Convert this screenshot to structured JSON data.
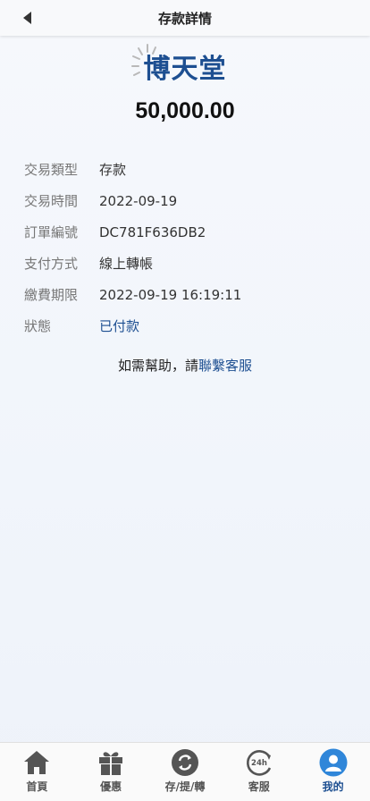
{
  "header": {
    "title": "存款詳情"
  },
  "logo": {
    "text": "博天堂"
  },
  "amount": "50,000.00",
  "details": [
    {
      "label": "交易類型",
      "value": "存款"
    },
    {
      "label": "交易時間",
      "value": "2022-09-19"
    },
    {
      "label": "訂單編號",
      "value": "DC781F636DB2"
    },
    {
      "label": "支付方式",
      "value": "線上轉帳"
    },
    {
      "label": "繳費期限",
      "value": "2022-09-19 16:19:11"
    },
    {
      "label": "狀態",
      "value": "已付款"
    }
  ],
  "help": {
    "prefix": "如需幫助，請",
    "link": "聯繫客服"
  },
  "tabs": [
    {
      "label": "首頁",
      "icon": "home-icon"
    },
    {
      "label": "優惠",
      "icon": "gift-icon"
    },
    {
      "label": "存/提/轉",
      "icon": "refresh-icon"
    },
    {
      "label": "客服",
      "icon": "support-24h-icon"
    },
    {
      "label": "我的",
      "icon": "user-icon",
      "active": true
    }
  ],
  "colors": {
    "accent": "#1d4f91",
    "text": "#222222",
    "muted": "#777777"
  }
}
